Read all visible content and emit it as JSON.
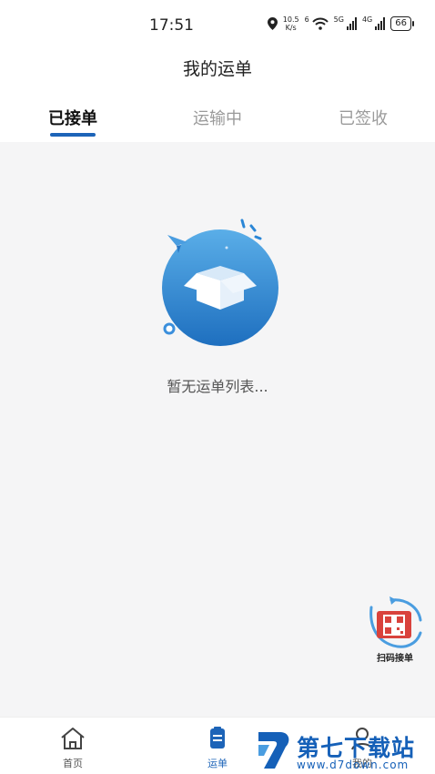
{
  "status_bar": {
    "time": "17:51",
    "speed_value": "10.5",
    "speed_unit": "K/s",
    "wifi_tag": "6",
    "signal1_tag": "5G",
    "signal2_tag": "4G",
    "battery": "66"
  },
  "header": {
    "title": "我的运单"
  },
  "tabs": [
    {
      "label": "已接单",
      "active": true
    },
    {
      "label": "运输中",
      "active": false
    },
    {
      "label": "已签收",
      "active": false
    }
  ],
  "empty_state": {
    "message": "暂无运单列表..."
  },
  "scan_button": {
    "label": "扫码接单"
  },
  "bottom_nav": [
    {
      "label": "首页",
      "icon": "home-icon",
      "active": false
    },
    {
      "label": "运单",
      "icon": "clipboard-icon",
      "active": true
    },
    {
      "label": "我的",
      "icon": "user-icon",
      "active": false
    }
  ],
  "watermark": {
    "title": "第七下载站",
    "url": "www.d7down.com"
  },
  "colors": {
    "accent": "#1d64b8",
    "inactive_tab": "#9a9a9a",
    "background": "#f5f5f6"
  }
}
